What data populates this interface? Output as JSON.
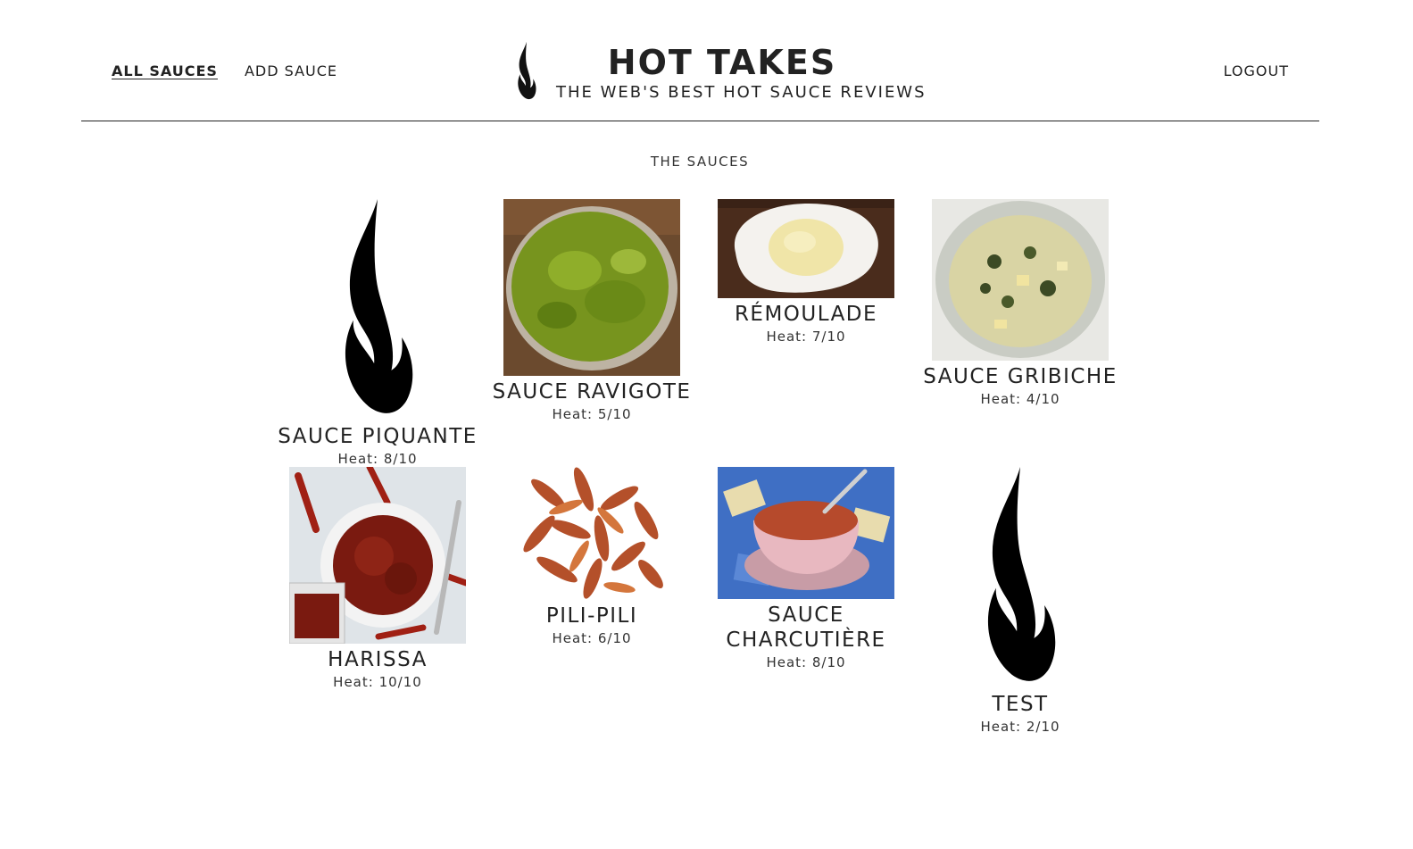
{
  "header": {
    "nav_left": [
      {
        "label": "ALL SAUCES",
        "active": true
      },
      {
        "label": "ADD SAUCE",
        "active": false
      }
    ],
    "brand_title": "HOT TAKES",
    "brand_subtitle": "THE WEB'S BEST HOT SAUCE REVIEWS",
    "logout_label": "LOGOUT"
  },
  "main": {
    "section_title": "THE SAUCES",
    "sauces": [
      {
        "name": "SAUCE PIQUANTE",
        "heat": "Heat: 8/10",
        "image": "flame-icon"
      },
      {
        "name": "SAUCE RAVIGOTE",
        "heat": "Heat: 5/10",
        "image": "green-sauce-bowl"
      },
      {
        "name": "RÉMOULADE",
        "heat": "Heat: 7/10",
        "image": "remoulade-plate"
      },
      {
        "name": "SAUCE GRIBICHE",
        "heat": "Heat: 4/10",
        "image": "gribiche-bowl"
      },
      {
        "name": "HARISSA",
        "heat": "Heat: 10/10",
        "image": "harissa-bowl"
      },
      {
        "name": "PILI-PILI",
        "heat": "Heat: 6/10",
        "image": "pili-pili-peppers"
      },
      {
        "name": "SAUCE CHARCUTIÈRE",
        "heat": "Heat: 8/10",
        "image": "charcutiere-gravy-boat"
      },
      {
        "name": "TEST",
        "heat": "Heat: 2/10",
        "image": "flame-icon"
      }
    ]
  },
  "colors": {
    "text": "#222222",
    "background": "#ffffff"
  }
}
